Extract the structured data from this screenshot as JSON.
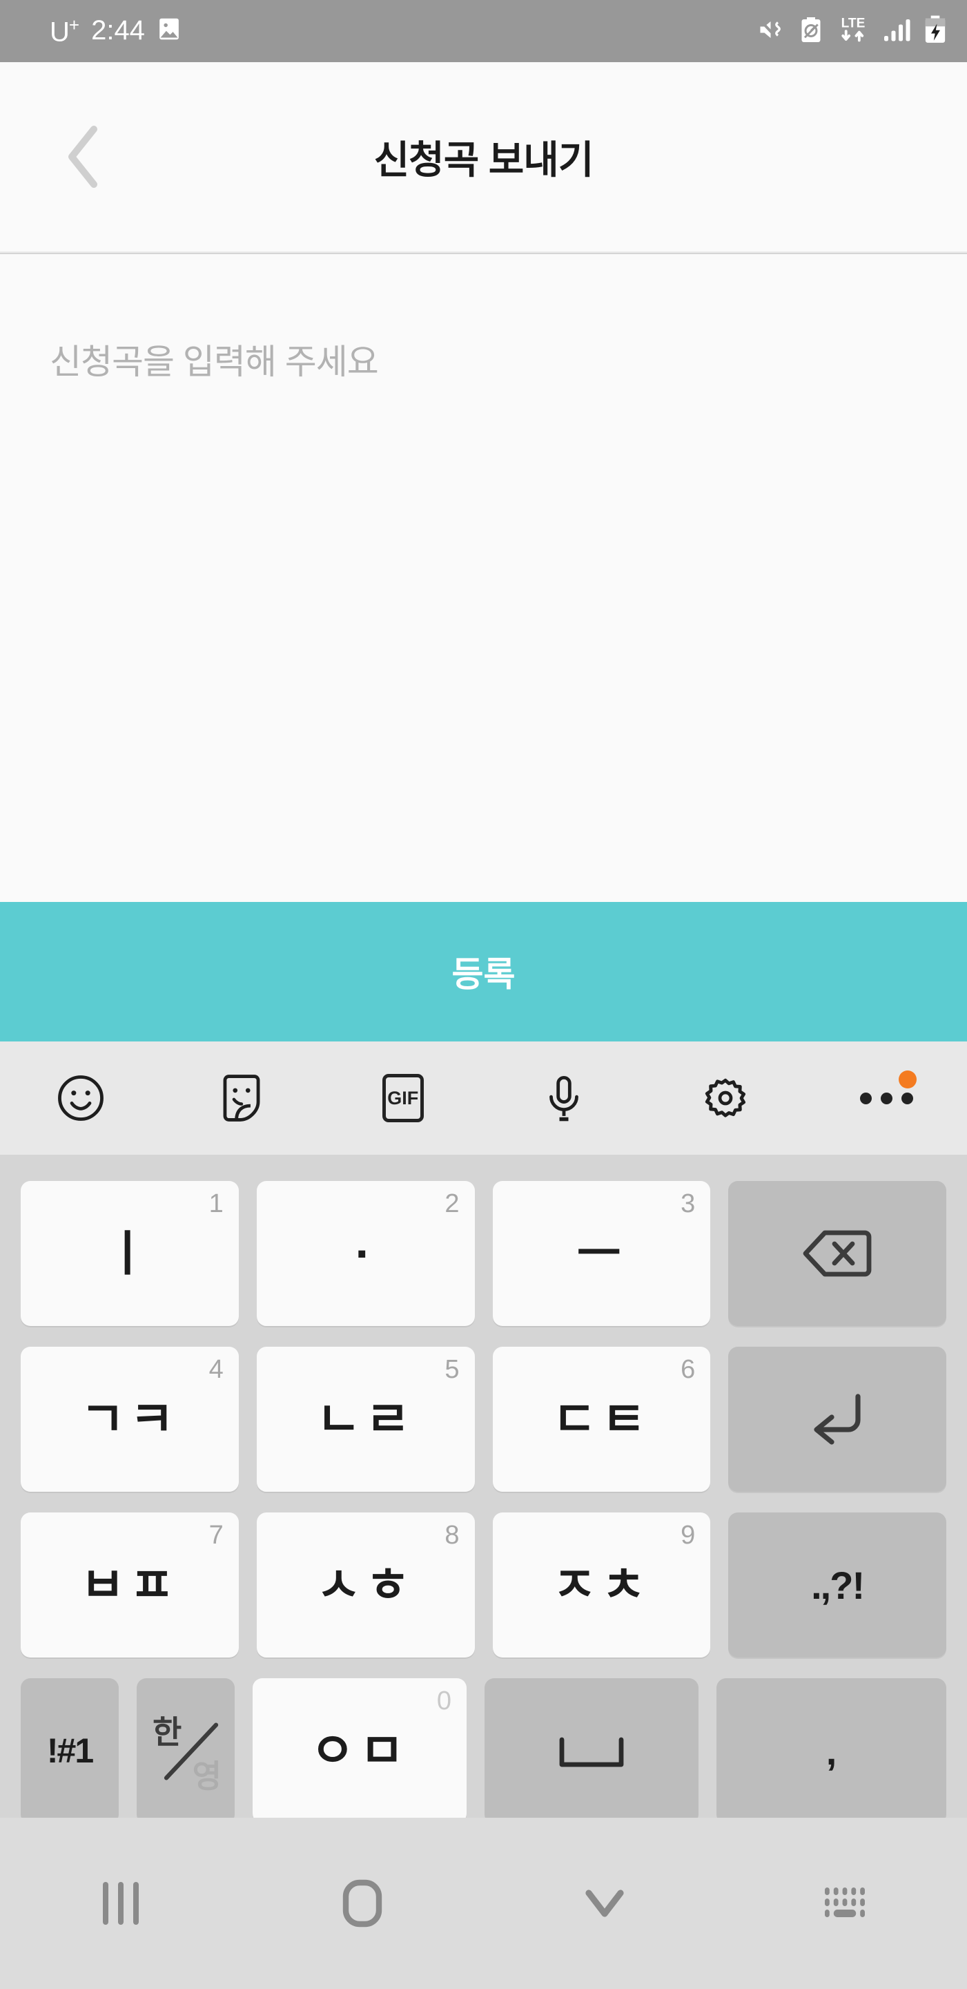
{
  "statusbar": {
    "carrier": "U",
    "carrier_plus": "+",
    "time": "2:44",
    "icons": [
      "image-icon",
      "mute-vibrate-icon",
      "data-saver-icon",
      "lte-icon",
      "signal-bars-icon",
      "battery-charging-icon"
    ],
    "network_label": "LTE"
  },
  "header": {
    "back_label": "back-chevron",
    "title": "신청곡 보내기"
  },
  "input": {
    "placeholder": "신청곡을 입력해 주세요",
    "value": ""
  },
  "submit": {
    "label": "등록",
    "color": "#5cccd1"
  },
  "keyboard_toolbar": {
    "items": [
      {
        "name": "emoji-icon",
        "label": "emoji"
      },
      {
        "name": "sticker-icon",
        "label": "sticker"
      },
      {
        "name": "gif-icon",
        "label": "GIF"
      },
      {
        "name": "microphone-icon",
        "label": "voice input"
      },
      {
        "name": "settings-gear-icon",
        "label": "settings"
      },
      {
        "name": "more-options-icon",
        "label": "more",
        "badge": true,
        "badge_color": "#f47b20"
      }
    ]
  },
  "keyboard": {
    "type": "cheonjiin",
    "rows": [
      [
        {
          "main": "ㅣ",
          "num": "1",
          "style": "light",
          "name": "key-i"
        },
        {
          "main": "·",
          "num": "2",
          "style": "light",
          "name": "key-dot"
        },
        {
          "main": "ㅡ",
          "num": "3",
          "style": "light",
          "name": "key-eu"
        },
        {
          "main": "",
          "num": "",
          "style": "dark",
          "name": "key-backspace",
          "icon": "backspace-icon"
        }
      ],
      [
        {
          "main": "ㄱㅋ",
          "num": "4",
          "style": "light",
          "name": "key-giyeok-kieuk"
        },
        {
          "main": "ㄴㄹ",
          "num": "5",
          "style": "light",
          "name": "key-nieun-rieul"
        },
        {
          "main": "ㄷㅌ",
          "num": "6",
          "style": "light",
          "name": "key-digeut-tieut"
        },
        {
          "main": "",
          "num": "",
          "style": "dark",
          "name": "key-enter",
          "icon": "enter-icon"
        }
      ],
      [
        {
          "main": "ㅂㅍ",
          "num": "7",
          "style": "light",
          "name": "key-bieup-pieup"
        },
        {
          "main": "ㅅㅎ",
          "num": "8",
          "style": "light",
          "name": "key-siot-hieut"
        },
        {
          "main": "ㅈㅊ",
          "num": "9",
          "style": "light",
          "name": "key-jieut-chieut"
        },
        {
          "main": ".,?!",
          "num": "",
          "style": "dark",
          "name": "key-punctuation"
        }
      ],
      [
        {
          "main": "!#1",
          "num": "",
          "style": "dark",
          "name": "key-symbols"
        },
        {
          "main": "한/영",
          "han": "한",
          "yeong": "영",
          "num": "",
          "style": "dark",
          "name": "key-language-toggle"
        },
        {
          "main": "ㅇㅁ",
          "num": "0",
          "style": "light",
          "name": "key-ieung-mieum"
        },
        {
          "main": "",
          "num": "",
          "style": "dark",
          "name": "key-space",
          "icon": "space-icon"
        },
        {
          "main": ",",
          "num": "",
          "style": "dark",
          "name": "key-comma"
        }
      ]
    ]
  },
  "navbar": {
    "items": [
      {
        "name": "recents-button",
        "label": "recents"
      },
      {
        "name": "home-button",
        "label": "home"
      },
      {
        "name": "hide-keyboard-button",
        "label": "hide keyboard"
      },
      {
        "name": "keyboard-switch-button",
        "label": "switch keyboard"
      }
    ]
  }
}
